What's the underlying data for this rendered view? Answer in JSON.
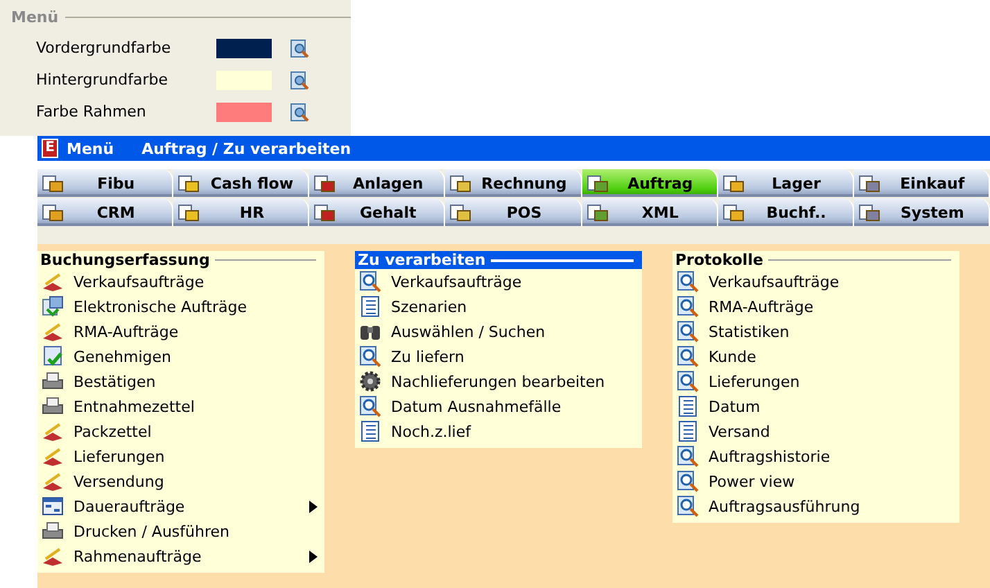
{
  "settings": {
    "legend": "Menü",
    "colors": [
      {
        "label": "Vordergrundfarbe",
        "color": "#002050"
      },
      {
        "label": "Hintergrundfarbe",
        "color": "#ffffd8"
      },
      {
        "label": "Farbe Rahmen",
        "color": "#ff7c7c"
      }
    ]
  },
  "menu_bar": {
    "logo": "E",
    "title": "Menü",
    "path": "Auftrag / Zu verarbeiten"
  },
  "tabs": [
    {
      "label": "Fibu",
      "selected": false
    },
    {
      "label": "Cash flow",
      "selected": false
    },
    {
      "label": "Anlagen",
      "selected": false
    },
    {
      "label": "Rechnung",
      "selected": false
    },
    {
      "label": "Auftrag",
      "selected": true
    },
    {
      "label": "Lager",
      "selected": false
    },
    {
      "label": "Einkauf",
      "selected": false
    },
    {
      "label": "CRM",
      "selected": false
    },
    {
      "label": "HR",
      "selected": false
    },
    {
      "label": "Gehalt",
      "selected": false
    },
    {
      "label": "POS",
      "selected": false
    },
    {
      "label": "XML",
      "selected": false
    },
    {
      "label": "Buchf..",
      "selected": false
    },
    {
      "label": "System",
      "selected": false
    }
  ],
  "columns": [
    {
      "title": "Buchungserfassung",
      "selected": false,
      "items": [
        {
          "label": "Verkaufsaufträge",
          "kind": "order",
          "submenu": false
        },
        {
          "label": "Elektronische Aufträge",
          "kind": "import",
          "submenu": false
        },
        {
          "label": "RMA-Aufträge",
          "kind": "order",
          "submenu": false
        },
        {
          "label": "Genehmigen",
          "kind": "approve",
          "submenu": false
        },
        {
          "label": "Bestätigen",
          "kind": "print",
          "submenu": false
        },
        {
          "label": "Entnahmezettel",
          "kind": "print",
          "submenu": false
        },
        {
          "label": "Packzettel",
          "kind": "order",
          "submenu": false
        },
        {
          "label": "Lieferungen",
          "kind": "order",
          "submenu": false
        },
        {
          "label": "Versendung",
          "kind": "order",
          "submenu": false
        },
        {
          "label": "Daueraufträge",
          "kind": "calendar",
          "submenu": true
        },
        {
          "label": "Drucken / Ausführen",
          "kind": "print",
          "submenu": false
        },
        {
          "label": "Rahmenaufträge",
          "kind": "order",
          "submenu": true
        }
      ]
    },
    {
      "title": "Zu verarbeiten",
      "selected": true,
      "items": [
        {
          "label": "Verkaufsaufträge",
          "kind": "search",
          "submenu": false
        },
        {
          "label": "Szenarien",
          "kind": "list",
          "submenu": false
        },
        {
          "label": "Auswählen / Suchen",
          "kind": "binoculars",
          "submenu": false
        },
        {
          "label": "Zu liefern",
          "kind": "search",
          "submenu": false
        },
        {
          "label": "Nachlieferungen bearbeiten",
          "kind": "gear",
          "submenu": false
        },
        {
          "label": "Datum Ausnahmefälle",
          "kind": "search",
          "submenu": false
        },
        {
          "label": "Noch.z.lief",
          "kind": "list",
          "submenu": false
        }
      ]
    },
    {
      "title": "Protokolle",
      "selected": false,
      "items": [
        {
          "label": "Verkaufsaufträge",
          "kind": "search",
          "submenu": false
        },
        {
          "label": "RMA-Aufträge",
          "kind": "search",
          "submenu": false
        },
        {
          "label": "Statistiken",
          "kind": "search",
          "submenu": false
        },
        {
          "label": "Kunde",
          "kind": "search",
          "submenu": false
        },
        {
          "label": "Lieferungen",
          "kind": "search",
          "submenu": false
        },
        {
          "label": "Datum",
          "kind": "list",
          "submenu": false
        },
        {
          "label": "Versand",
          "kind": "list",
          "submenu": false
        },
        {
          "label": "Auftragshistorie",
          "kind": "search",
          "submenu": false
        },
        {
          "label": "Power view",
          "kind": "search",
          "submenu": false
        },
        {
          "label": "Auftragsausführung",
          "kind": "search",
          "submenu": false
        }
      ]
    }
  ]
}
